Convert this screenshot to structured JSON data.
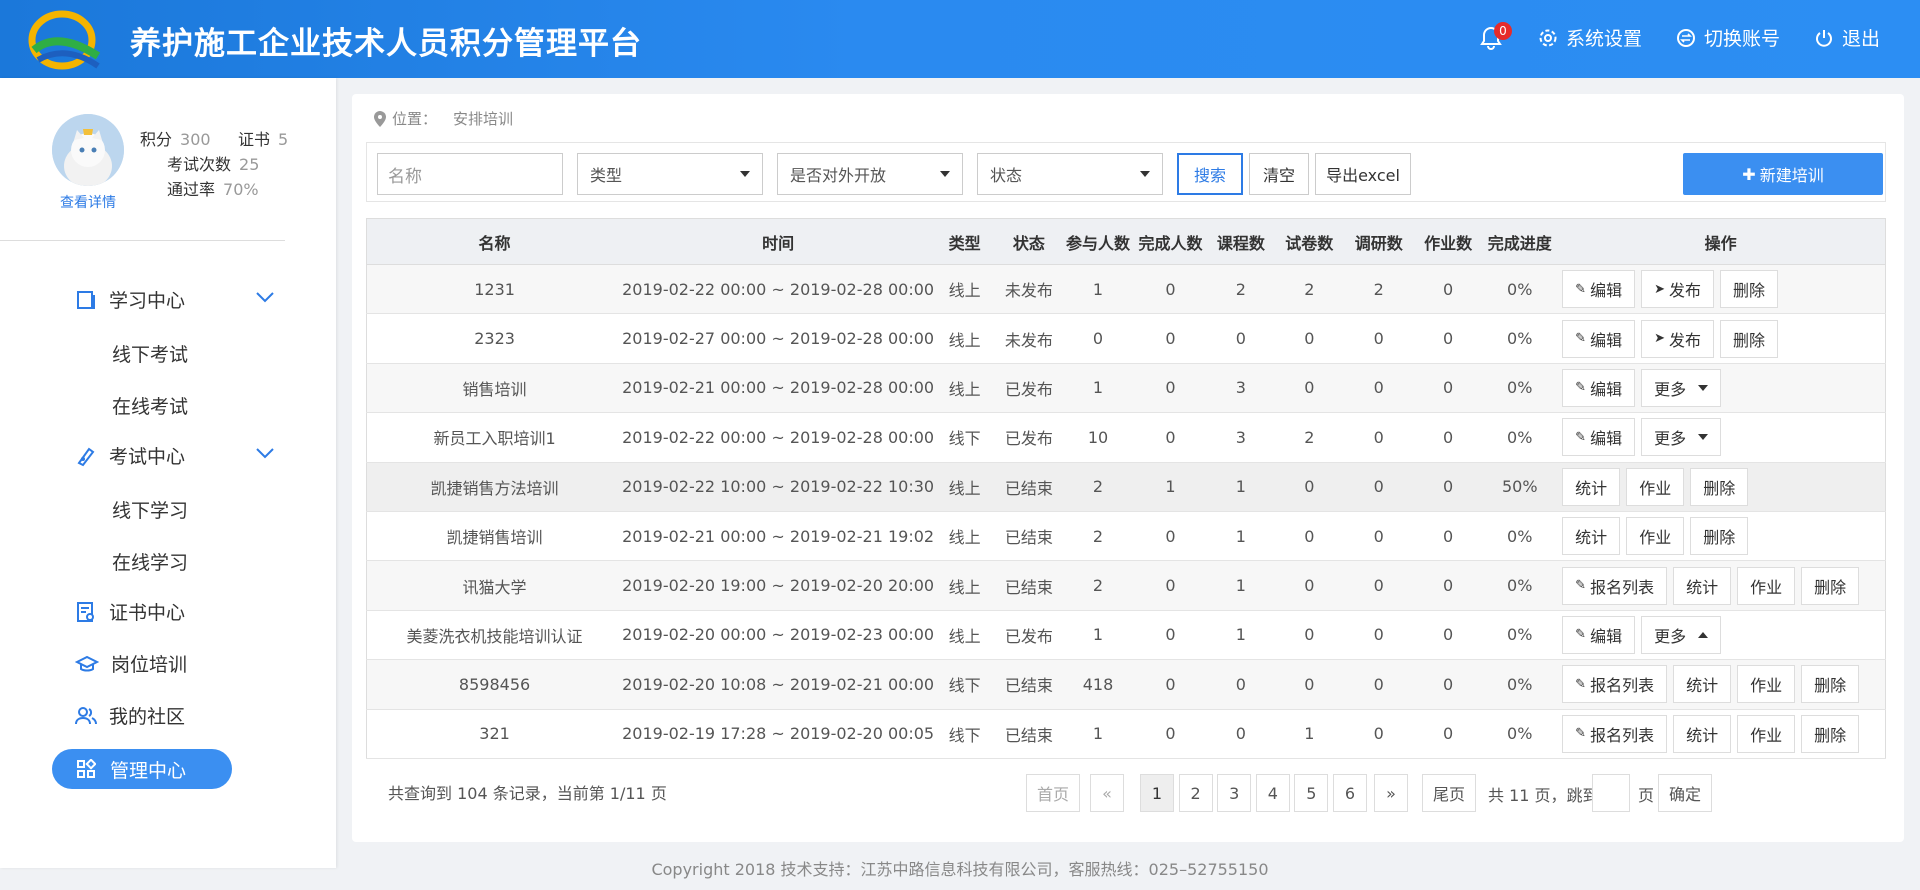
{
  "header": {
    "title": "养护施工企业技术人员积分管理平台",
    "notify_count": "0",
    "settings": "系统设置",
    "switch": "切换账号",
    "logout": "退出",
    "brand_color": "#2a8af0"
  },
  "profile": {
    "points_label": "积分",
    "points": "300",
    "certs_label": "证书",
    "certs": "5",
    "exams_label": "考试次数",
    "exams": "25",
    "pass_label": "通过率",
    "pass": "70%",
    "detail_link": "查看详情"
  },
  "menu": {
    "study": "学习中心",
    "offline_exam": "线下考试",
    "online_exam": "在线考试",
    "exam": "考试中心",
    "offline_study": "线下学习",
    "online_study": "在线学习",
    "cert": "证书中心",
    "post": "岗位培训",
    "community": "我的社区",
    "manage": "管理中心"
  },
  "breadcrumb": {
    "label": "位置：",
    "current": "安排培训"
  },
  "filter": {
    "name_placeholder": "名称",
    "type": "类型",
    "open": "是否对外开放",
    "status": "状态",
    "search": "搜索",
    "clear": "清空",
    "export": "导出excel",
    "new": "新建培训"
  },
  "table": {
    "headers": [
      "名称",
      "时间",
      "类型",
      "状态",
      "参与人数",
      "完成人数",
      "课程数",
      "试卷数",
      "调研数",
      "作业数",
      "完成进度",
      "操作"
    ],
    "rows": [
      {
        "name": "1231",
        "time": "2019-02-22 00:00 ~ 2019-02-28 00:00",
        "type": "线上",
        "status": "未发布",
        "join": "1",
        "done": "0",
        "course": "2",
        "paper": "2",
        "survey": "2",
        "work": "0",
        "progress": "0%",
        "ops": [
          "编辑",
          "发布",
          "删除"
        ]
      },
      {
        "name": "2323",
        "time": "2019-02-27 00:00 ~ 2019-02-28 00:00",
        "type": "线上",
        "status": "未发布",
        "join": "0",
        "done": "0",
        "course": "0",
        "paper": "0",
        "survey": "0",
        "work": "0",
        "progress": "0%",
        "ops": [
          "编辑",
          "发布",
          "删除"
        ]
      },
      {
        "name": "销售培训",
        "time": "2019-02-21 00:00 ~ 2019-02-28 00:00",
        "type": "线上",
        "status": "已发布",
        "join": "1",
        "done": "0",
        "course": "3",
        "paper": "0",
        "survey": "0",
        "work": "0",
        "progress": "0%",
        "ops": [
          "编辑",
          "更多"
        ]
      },
      {
        "name": "新员工入职培训1",
        "time": "2019-02-22 00:00 ~ 2019-02-28 00:00",
        "type": "线下",
        "status": "已发布",
        "join": "10",
        "done": "0",
        "course": "3",
        "paper": "2",
        "survey": "0",
        "work": "0",
        "progress": "0%",
        "ops": [
          "编辑",
          "更多"
        ]
      },
      {
        "name": "凯捷销售方法培训",
        "time": "2019-02-22 10:00 ~ 2019-02-22 10:30",
        "type": "线上",
        "status": "已结束",
        "join": "2",
        "done": "1",
        "course": "1",
        "paper": "0",
        "survey": "0",
        "work": "0",
        "progress": "50%",
        "ops": [
          "统计",
          "作业",
          "删除"
        ]
      },
      {
        "name": "凯捷销售培训",
        "time": "2019-02-21 00:00 ~ 2019-02-21 19:02",
        "type": "线上",
        "status": "已结束",
        "join": "2",
        "done": "0",
        "course": "1",
        "paper": "0",
        "survey": "0",
        "work": "0",
        "progress": "0%",
        "ops": [
          "统计",
          "作业",
          "删除"
        ]
      },
      {
        "name": "讯猫大学",
        "time": "2019-02-20 19:00 ~ 2019-02-20 20:00",
        "type": "线上",
        "status": "已结束",
        "join": "2",
        "done": "0",
        "course": "1",
        "paper": "0",
        "survey": "0",
        "work": "0",
        "progress": "0%",
        "ops": [
          "报名列表",
          "统计",
          "作业",
          "删除"
        ]
      },
      {
        "name": "美菱洗衣机技能培训认证",
        "time": "2019-02-20 00:00 ~ 2019-02-23 00:00",
        "type": "线上",
        "status": "已发布",
        "join": "1",
        "done": "0",
        "course": "1",
        "paper": "0",
        "survey": "0",
        "work": "0",
        "progress": "0%",
        "ops": [
          "编辑",
          "更多"
        ]
      },
      {
        "name": "8598456",
        "time": "2019-02-20 10:08 ~ 2019-02-21 00:00",
        "type": "线下",
        "status": "已结束",
        "join": "418",
        "done": "0",
        "course": "0",
        "paper": "0",
        "survey": "0",
        "work": "0",
        "progress": "0%",
        "ops": [
          "报名列表",
          "统计",
          "作业",
          "删除"
        ]
      },
      {
        "name": "321",
        "time": "2019-02-19 17:28 ~ 2019-02-20 00:05",
        "type": "线下",
        "status": "已结束",
        "join": "1",
        "done": "0",
        "course": "0",
        "paper": "1",
        "survey": "0",
        "work": "0",
        "progress": "0%",
        "ops": [
          "报名列表",
          "统计",
          "作业",
          "删除"
        ]
      }
    ]
  },
  "pager": {
    "info": "共查询到 104 条记录，当前第 1/11 页",
    "first": "首页",
    "prev": "«",
    "pages": [
      "1",
      "2",
      "3",
      "4",
      "5",
      "6"
    ],
    "next": "»",
    "last": "尾页",
    "total": "共 11 页，跳到第",
    "page_unit": "页",
    "go": "确定"
  },
  "footer": "Copyright 2018 技术支持：江苏中路信息科技有限公司，客服热线：025–52755150"
}
